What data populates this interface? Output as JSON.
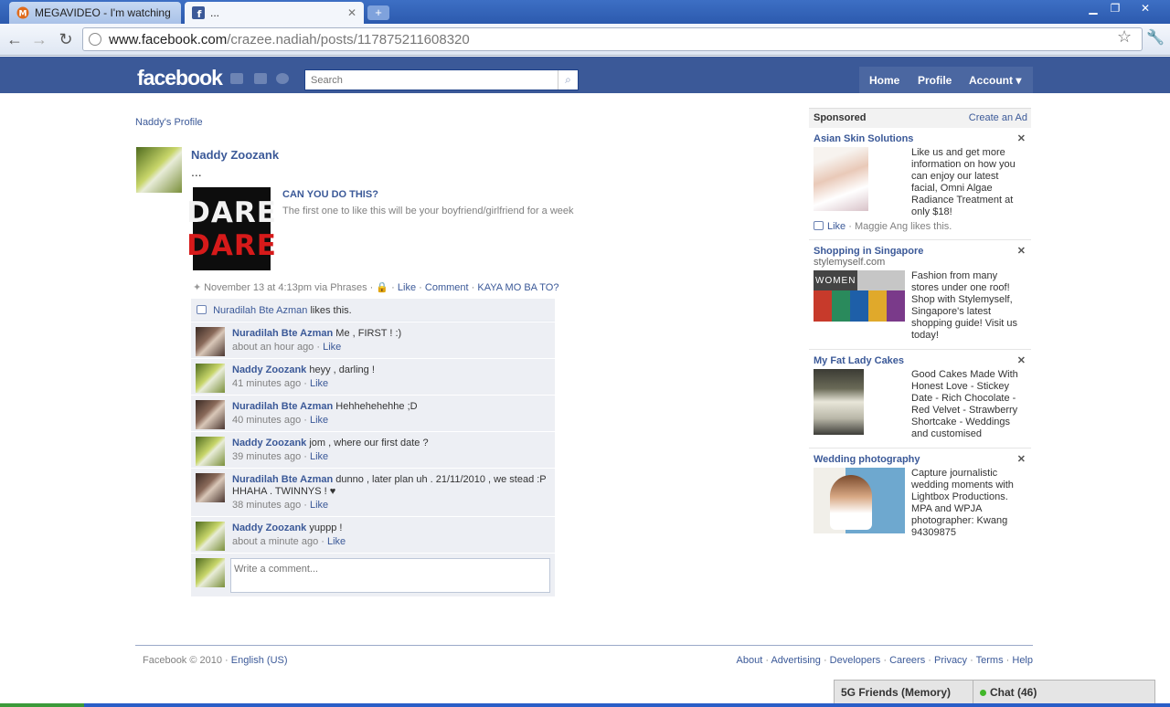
{
  "browser": {
    "tabs": [
      {
        "title": "MEGAVIDEO - I'm watching it",
        "active": false
      },
      {
        "title": "...",
        "active": true
      }
    ],
    "url_host": "www.facebook.com",
    "url_path": "/crazee.nadiah/posts/117875211608320"
  },
  "header": {
    "logo": "facebook",
    "search_placeholder": "Search",
    "nav": {
      "home": "Home",
      "profile": "Profile",
      "account": "Account ▾"
    }
  },
  "breadcrumb": "Naddy's Profile",
  "post": {
    "author": "Naddy Zoozank",
    "message": "...",
    "attachment": {
      "image_top": "DARE",
      "image_bottom": "DARE",
      "title": "CAN YOU DO THIS?",
      "description": "The first one to like this will be your boyfriend/girlfriend for a week"
    },
    "meta": {
      "time": "November 13 at 4:13pm via Phrases",
      "sep": "·",
      "like": "Like",
      "comment": "Comment",
      "extra": "KAYA MO BA TO?"
    },
    "likes": {
      "name": "Nuradilah Bte Azman",
      "text": "likes this."
    }
  },
  "comments": [
    {
      "author": "Nuradilah Bte Azman",
      "text": "Me , FIRST ! :)",
      "time": "about an hour ago",
      "like": "Like",
      "avatar": "alt"
    },
    {
      "author": "Naddy Zoozank",
      "text": "heyy , darling !",
      "time": "41 minutes ago",
      "like": "Like",
      "avatar": "main"
    },
    {
      "author": "Nuradilah Bte Azman",
      "text": "Hehhehehehhe ;D",
      "time": "40 minutes ago",
      "like": "Like",
      "avatar": "alt"
    },
    {
      "author": "Naddy Zoozank",
      "text": "jom , where our first date ?",
      "time": "39 minutes ago",
      "like": "Like",
      "avatar": "main"
    },
    {
      "author": "Nuradilah Bte Azman",
      "text": "dunno , later plan uh . 21/11/2010 , we stead :P",
      "text2": "HHAHA . TWINNYS ! ♥",
      "time": "38 minutes ago",
      "like": "Like",
      "avatar": "alt"
    },
    {
      "author": "Naddy Zoozank",
      "text": "yuppp !",
      "time": "about a minute ago",
      "like": "Like",
      "avatar": "main"
    }
  ],
  "comment_input_placeholder": "Write a comment...",
  "sponsored": {
    "heading": "Sponsored",
    "create": "Create an Ad",
    "ads": [
      {
        "title": "Asian Skin Solutions",
        "url": "",
        "text": "Like us and get more information on how you can enjoy our latest facial, Omni Algae Radiance Treatment at only $18!",
        "like": "Like",
        "likes_text": "· Maggie Ang likes this."
      },
      {
        "title": "Shopping in Singapore",
        "url": "stylemyself.com",
        "text": "Fashion from many stores under one roof! Shop with Stylemyself, Singapore's latest shopping guide! Visit us today!",
        "img_label": "WOMEN"
      },
      {
        "title": "My Fat Lady Cakes",
        "url": "",
        "text": "Good Cakes Made With Honest Love - Stickey Date - Rich Chocolate - Red Velvet - Strawberry Shortcake - Weddings and customised"
      },
      {
        "title": "Wedding photography",
        "url": "",
        "text": "Capture journalistic wedding moments with Lightbox Productions. MPA and WPJA photographer: Kwang 94309875"
      }
    ]
  },
  "footer": {
    "copyright": "Facebook © 2010 ·",
    "language": "English (US)",
    "links": [
      "About",
      "Advertising",
      "Developers",
      "Careers",
      "Privacy",
      "Terms",
      "Help"
    ]
  },
  "chat": {
    "friends": "5G Friends (Memory)",
    "chat": "Chat (46)"
  },
  "colors": {
    "fb_blue": "#3b5998",
    "link": "#3b5998",
    "comment_bg": "#edeff4"
  }
}
